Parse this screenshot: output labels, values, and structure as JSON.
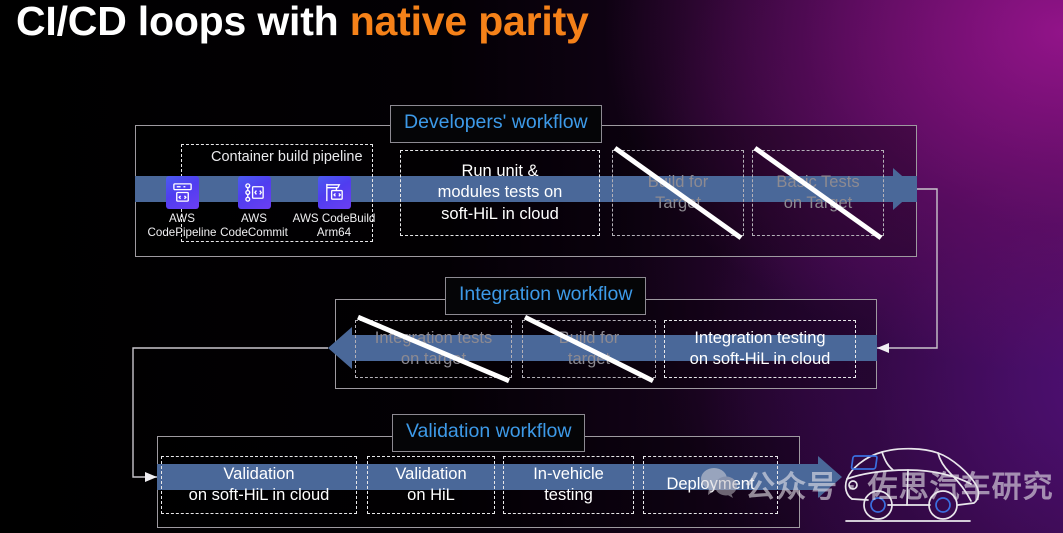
{
  "title": {
    "part_white": "CI/CD loops with ",
    "part_orange": "native parity",
    "accent_color": "#f58119"
  },
  "colors": {
    "band_blue": "#4a6899",
    "chip_text": "#3d9ae8",
    "dim_text": "#8d8a91",
    "aws_icon_blue": "#4f3df0"
  },
  "workflows": [
    {
      "chip": "Developers' workflow",
      "subgroup_label": "Container build pipeline",
      "aws_services": [
        {
          "icon": "aws-codepipeline-icon",
          "line1": "AWS",
          "line2": "CodePipeline"
        },
        {
          "icon": "aws-codecommit-icon",
          "line1": "AWS",
          "line2": "CodeCommit"
        },
        {
          "icon": "aws-codebuild-icon",
          "line1": "AWS CodeBuild",
          "line2": "Arm64"
        }
      ],
      "steps": [
        {
          "line1": "Run unit &",
          "line2": "modules tests on",
          "line3": "soft-HiL in cloud",
          "struck": false
        },
        {
          "line1": "Build for",
          "line2": "Target",
          "struck": true
        },
        {
          "line1": "Basic Tests",
          "line2": "on Target",
          "struck": true
        }
      ]
    },
    {
      "chip": "Integration workflow",
      "steps": [
        {
          "line1": "Integration tests",
          "line2": "on target",
          "struck": true
        },
        {
          "line1": "Build for",
          "line2": "target",
          "struck": true
        },
        {
          "line1": "Integration testing",
          "line2": "on soft-HiL in cloud",
          "struck": false
        }
      ]
    },
    {
      "chip": "Validation workflow",
      "steps": [
        {
          "line1": "Validation",
          "line2": "on soft-HiL in cloud",
          "struck": false
        },
        {
          "line1": "Validation",
          "line2": "on HiL",
          "struck": false
        },
        {
          "line1": "In-vehicle",
          "line2": "testing",
          "struck": false
        },
        {
          "line1": "Deployment",
          "line2": "",
          "struck": false
        }
      ]
    }
  ],
  "watermark": {
    "text": "公众号 · 佐思汽车研究",
    "logo": "wechat-logo-icon"
  },
  "illustration": {
    "car": "car-line-art-icon"
  }
}
